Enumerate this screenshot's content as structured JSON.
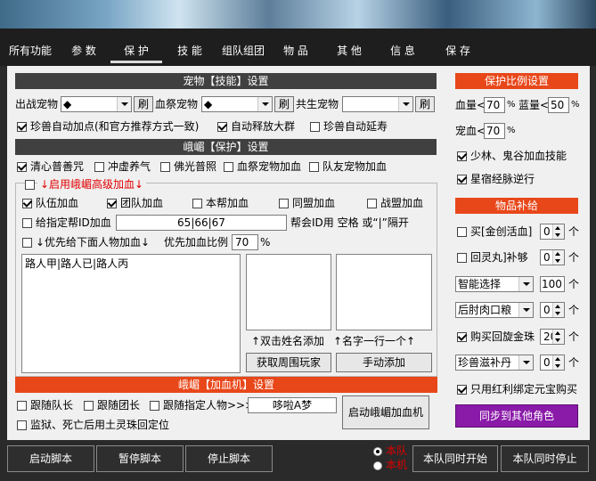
{
  "tabs": [
    "所有功能",
    "参 数",
    "保 护",
    "技 能",
    "组队组团",
    "物 品",
    "其 他",
    "信 息",
    "保 存"
  ],
  "pet_skill": {
    "header": "宠物【技能】设置",
    "battle_pet_label": "出战宠物",
    "battle_pet_value": "◆",
    "refresh": "刷",
    "blood_pet_label": "血祭宠物",
    "blood_pet_value": "◆",
    "shared_pet_label": "共生宠物",
    "shared_pet_value": "",
    "auto_points": "珍兽自动加点(和官方推荐方式一致)",
    "auto_release": "自动释放大群",
    "auto_extend": "珍兽自动延寿"
  },
  "emei_protect": {
    "header": "峨嵋【保护】设置",
    "opts": [
      "清心普善咒",
      "冲虚养气",
      "佛光普照",
      "血祭宠物加血",
      "队友宠物加血"
    ],
    "advanced_heal": "↓启用峨嵋高级加血↓",
    "targets": [
      "队伍加血",
      "团队加血",
      "本帮加血",
      "同盟加血",
      "战盟加血"
    ],
    "give_guild_label": "给指定帮ID加血",
    "guild_ids": "65|66|67",
    "guild_hint": "帮会ID用 空格 或“|”隔开",
    "priority_label": "↓优先给下面人物加血↓",
    "priority_ratio_label": "优先加血比例",
    "priority_ratio": "70",
    "percent": "%",
    "names_list": "路人甲|路人已|路人丙",
    "hint_dblclick": "↑双击姓名添加",
    "hint_one_per_line": "↑名字一行一个↑",
    "btn_get_players": "获取周围玩家",
    "btn_manual_add": "手动添加"
  },
  "emei_heal_bot": {
    "header": "峨嵋【加血机】设置",
    "follow_leader": "跟随队长",
    "follow_team_leader": "跟随团长",
    "follow_person": "跟随指定人物>>>",
    "person_name": "哆啦A梦",
    "btn_start": "启动峨嵋加血机",
    "prison_death": "监狱、死亡后用土灵珠回定位"
  },
  "protect_ratio": {
    "header": "保护比例设置",
    "hp_label": "血量<",
    "hp_value": "70",
    "mp_label": "蓝量<",
    "mp_value": "50",
    "pet_label": "宠血<",
    "pet_value": "70",
    "percent": "%",
    "shaolin": "少林、鬼谷加血技能",
    "star": "星宿经脉逆行"
  },
  "supply": {
    "header": "物品补给",
    "buy_medicine": "买[金创活血]",
    "buy_medicine_count": "0",
    "return_pill": "回灵丸]补够",
    "return_pill_count": "0",
    "smart_select": "智能选择",
    "smart_count": "100",
    "meat_option": "后肘肉口粮",
    "meat_count": "0",
    "buy_pearl": "购买回旋金珠",
    "pearl_count": "20",
    "pet_supply": "珍兽滋补丹",
    "pet_supply_count": "0",
    "unit": "个",
    "only_bound": "只用红利绑定元宝购买",
    "sync_btn": "同步到其他角色"
  },
  "bottom": {
    "start_script": "启动脚本",
    "pause_script": "暂停脚本",
    "stop_script": "停止脚本",
    "radio_team": "本队",
    "radio_self": "本机",
    "team_start": "本队同时开始",
    "team_stop": "本队同时停止"
  },
  "colors": {
    "header_dark": "#404040",
    "header_red": "#e8471a",
    "sync_btn": "#8a1aa8",
    "label_red": "#e00000"
  }
}
